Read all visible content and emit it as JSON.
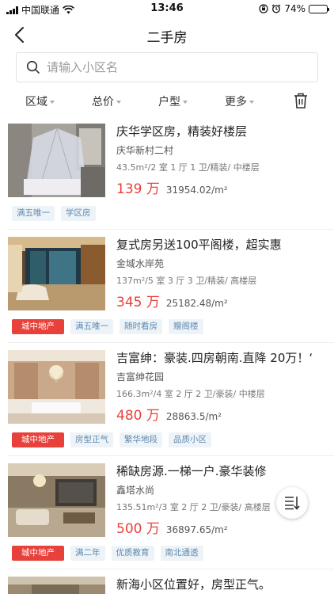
{
  "status_bar": {
    "carrier": "中国联通",
    "time": "13:46",
    "battery": "74%",
    "battery_level": 0.74
  },
  "nav": {
    "title": "二手房"
  },
  "search": {
    "placeholder": "请输入小区名",
    "value": ""
  },
  "filters": {
    "district": "区域",
    "price": "总价",
    "layout": "户型",
    "more": "更多"
  },
  "listings": [
    {
      "name": "庆华学区房，精装好楼层",
      "community": "庆华新村二村",
      "info": "43.5m²/2 室 1 厅 1 卫/精装/ 中楼层",
      "price": "139 万",
      "unit_price": "31954.02/m²",
      "tags": [
        "满五唯一",
        "学区房"
      ]
    },
    {
      "name": "复式房另送100平阁楼，超实惠",
      "community": "金域水岸苑",
      "info": "137m²/5 室 3 厅 3 卫/精装/ 高楼层",
      "price": "345 万",
      "unit_price": "25182.48/m²",
      "brand_tag": "城中地产",
      "tags": [
        "满五唯一",
        "随时看房",
        "赠阁楼"
      ]
    },
    {
      "name": "吉富绅：豪装.四房朝南.直降 20万！‘",
      "community": "吉富绅花园",
      "info": "166.3m²/4 室 2 厅 2 卫/豪装/ 中楼层",
      "price": "480 万",
      "unit_price": "28863.5/m²",
      "brand_tag": "城中地产",
      "tags": [
        "房型正气",
        "繁华地段",
        "品质小区"
      ]
    },
    {
      "name": "稀缺房源.一梯一户.豪华装修",
      "community": "鑫塔水尚",
      "info": "135.51m²/3 室 2 厅 2 卫/豪装/ 高楼层",
      "price": "500 万",
      "unit_price": "36897.65/m²",
      "brand_tag": "城中地产",
      "tags": [
        "满二年",
        "优质教育",
        "南北通透"
      ]
    },
    {
      "name": "新海小区位置好，房型正气。"
    }
  ]
}
